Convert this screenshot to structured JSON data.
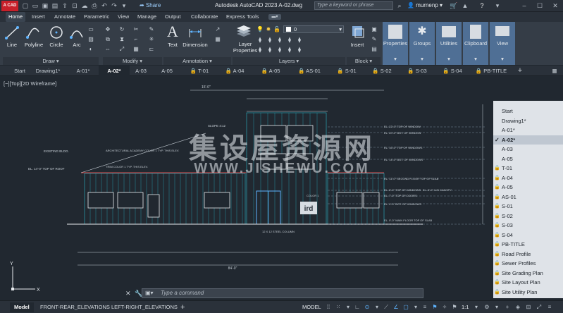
{
  "titlebar": {
    "logo": "A CAD",
    "share": "Share",
    "title": "Autodesk AutoCAD 2023   A-02.dwg",
    "search_placeholder": "Type a keyword or phrase",
    "user": "murnenp",
    "help": "?"
  },
  "menu": [
    "Home",
    "Insert",
    "Annotate",
    "Parametric",
    "View",
    "Manage",
    "Output",
    "Collaborate",
    "Express Tools"
  ],
  "ribbon": {
    "draw": {
      "line": "Line",
      "polyline": "Polyline",
      "circle": "Circle",
      "arc": "Arc",
      "panel": "Draw"
    },
    "modify": {
      "panel": "Modify"
    },
    "annotation": {
      "text": "Text",
      "dimension": "Dimension",
      "panel": "Annotation"
    },
    "layers": {
      "layer_properties": "Layer\nProperties",
      "current_layer": "0",
      "panel": "Layers"
    },
    "block": {
      "insert": "Insert",
      "panel": "Block"
    },
    "big_buttons": [
      "Properties",
      "Groups",
      "Utilities",
      "Clipboard",
      "View"
    ]
  },
  "file_tabs": [
    "Start",
    "Drawing1*",
    "A-01*",
    "A-02*",
    "A-03",
    "A-05",
    "T-01",
    "A-04",
    "A-05",
    "AS-01",
    "S-01",
    "S-02",
    "S-03",
    "S-04",
    "PB-TITLE"
  ],
  "viewport": {
    "label": "[−][Top][2D Wireframe]"
  },
  "dropdown": {
    "items": [
      {
        "label": "Start",
        "lock": false,
        "selected": false
      },
      {
        "label": "Drawing1*",
        "lock": false,
        "selected": false
      },
      {
        "label": "A-01*",
        "lock": false,
        "selected": false
      },
      {
        "label": "A-02*",
        "lock": false,
        "selected": true
      },
      {
        "label": "A-03",
        "lock": false,
        "selected": false
      },
      {
        "label": "A-05",
        "lock": false,
        "selected": false
      },
      {
        "label": "T-01",
        "lock": true,
        "selected": false
      },
      {
        "label": "A-04",
        "lock": true,
        "selected": false
      },
      {
        "label": "A-05",
        "lock": true,
        "selected": false
      },
      {
        "label": "AS-01",
        "lock": true,
        "selected": false
      },
      {
        "label": "S-01",
        "lock": true,
        "selected": false
      },
      {
        "label": "S-02",
        "lock": true,
        "selected": false
      },
      {
        "label": "S-03",
        "lock": true,
        "selected": false
      },
      {
        "label": "S-04",
        "lock": true,
        "selected": false
      },
      {
        "label": "PB-TITLE",
        "lock": true,
        "selected": false
      },
      {
        "label": "Road Profile",
        "lock": true,
        "selected": false
      },
      {
        "label": "Sewer Profiles",
        "lock": true,
        "selected": false
      },
      {
        "label": "Site Grading Plan",
        "lock": true,
        "selected": false
      },
      {
        "label": "Site Layout Plan",
        "lock": true,
        "selected": false
      },
      {
        "label": "Site Utility Plan",
        "lock": true,
        "selected": false
      }
    ]
  },
  "drawing": {
    "notes_left": [
      "EXISTING BLDG.",
      "EL. 14'-0\" TOP OF ROOF",
      "ARCHITECTURAL ACADEMY COLOR 1 TYP. THIS ELEV.",
      "TRIM COLOR 1 TYP. THIS ELEV.",
      "SLOPE 4:12"
    ],
    "notes_right": [
      "EL. 22'-0\" TOP OF WINDOW",
      "EL. 20'-0\" BOT. OF WINDOW",
      "EL. 16'-0\" TOP OF WINDOWS",
      "EL. 14'-0\" BOT. OF WINDOWS",
      "EL. 11'-0\" SECOND FLOOR TOP OF SLAB",
      "EL. 8'-0\" TOP OF WINDOWS",
      "EL. 7'-0\" TOP OF DOORS",
      "EL. 4'-0\" BOT. OF WINDOWS",
      "EL. 0'-0\" MAIN FLOOR TOP OF SLAB"
    ],
    "note_steel": "12 X 12 STEEL COLUMN",
    "note_canopy": "EL. 8'-0\" U/S CANOPY",
    "note_color": "COLOR 1",
    "dim_bottom": "84'-0\"",
    "dim_top": "15'-0\"",
    "sign_text": "ird"
  },
  "watermark": {
    "line1": "集设屋资源网",
    "line2": "WWW.JISHEWU.COM"
  },
  "command": {
    "placeholder": "Type a command"
  },
  "status": {
    "layouts": [
      "Model",
      "FRONT-REAR_ELEVATIONS",
      "LEFT-RIGHT_ELEVATIONS"
    ],
    "mode": "MODEL",
    "scale": "1:1"
  }
}
